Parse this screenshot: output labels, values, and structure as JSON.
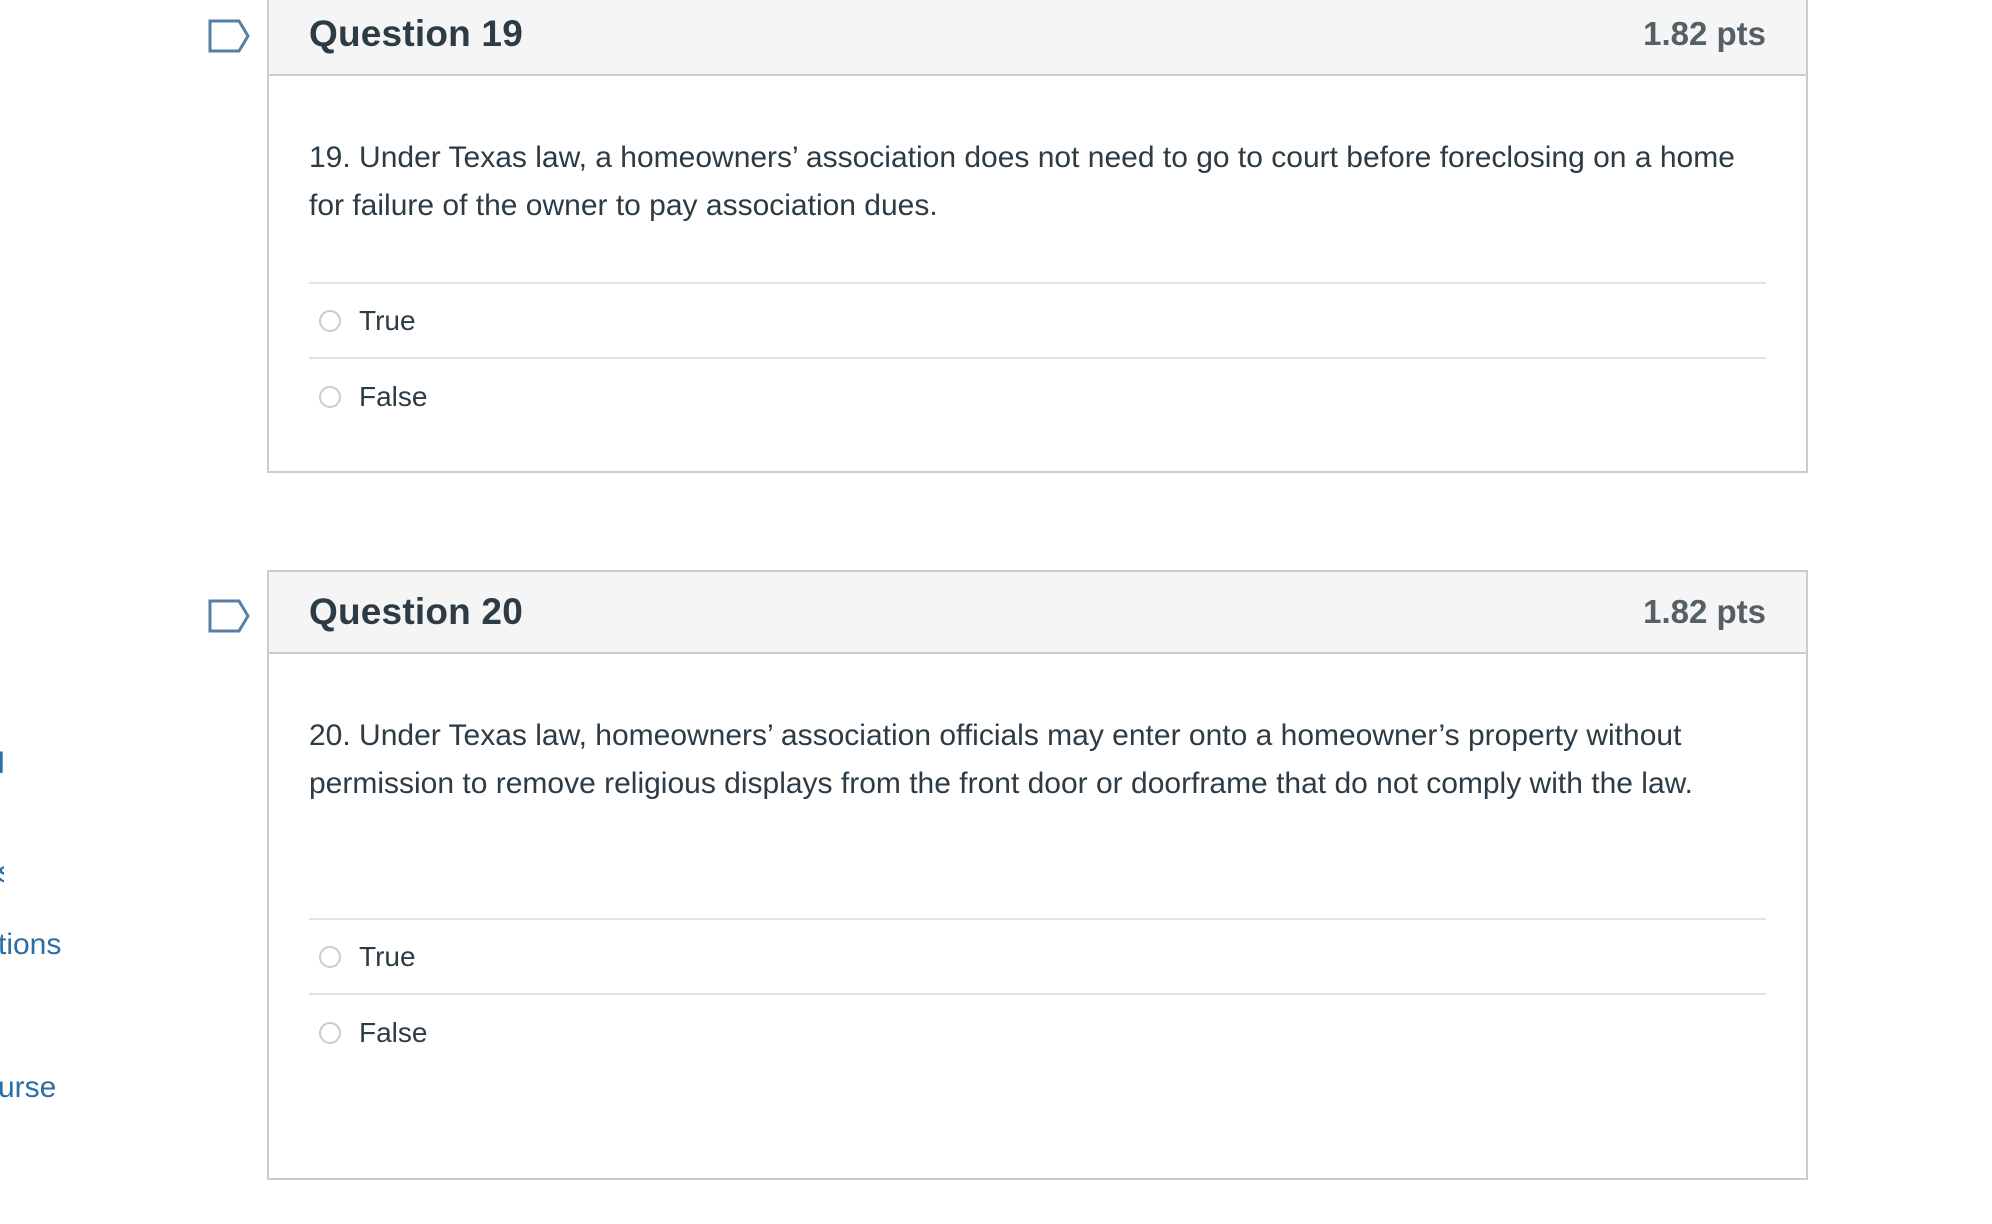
{
  "left_nav": {
    "items": [
      {
        "label": "Discussions",
        "visible_text": "tions"
      },
      {
        "label": "Course",
        "visible_text": "urse"
      }
    ],
    "fragments": [
      "l",
      "s"
    ]
  },
  "questions": [
    {
      "title": "Question 19",
      "points": "1.82 pts",
      "text": "19.  Under Texas law, a homeowners’ association does not need to go to court before foreclosing on a home for failure of the owner to pay association dues.",
      "answers": [
        {
          "label": "True",
          "selected": false
        },
        {
          "label": "False",
          "selected": false
        }
      ]
    },
    {
      "title": "Question 20",
      "points": "1.82 pts",
      "text": "20.  Under Texas law, homeowners’ association officials may enter onto a homeowner’s property without permission to remove religious displays from the front door or doorframe that do not comply with the law.",
      "answers": [
        {
          "label": "True",
          "selected": false
        },
        {
          "label": "False",
          "selected": false
        }
      ]
    }
  ],
  "colors": {
    "link": "#2b6ea6",
    "header_bg": "#f5f5f5",
    "border": "#c7cdd1",
    "text": "#2d3b45",
    "flag": "#5a7fa6"
  },
  "icons": {
    "flag": "flag-outline-icon",
    "radio": "radio-unchecked-icon"
  }
}
